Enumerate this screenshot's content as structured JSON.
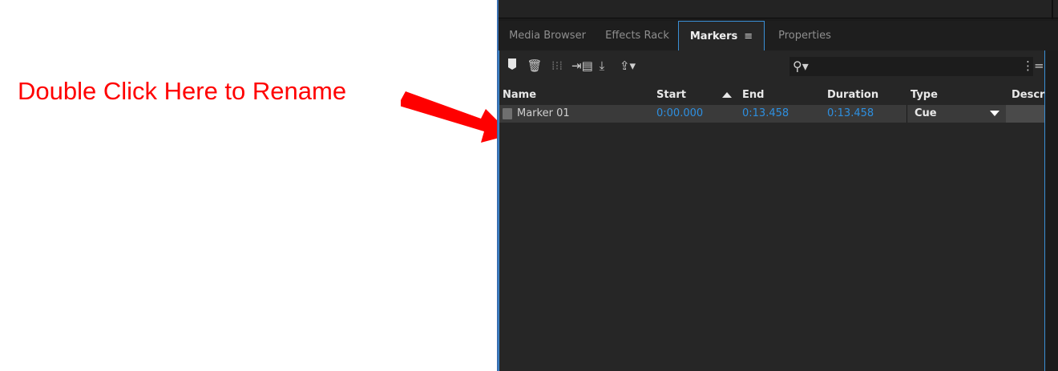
{
  "annotation": {
    "text": "Double Click Here to Rename",
    "color": "#ff0000"
  },
  "tabs": [
    {
      "label": "Media Browser",
      "active": false
    },
    {
      "label": "Effects Rack",
      "active": false
    },
    {
      "label": "Markers",
      "active": true
    },
    {
      "label": "Properties",
      "active": false
    }
  ],
  "toolbar": {
    "icons": [
      "marker-add-icon",
      "trash-icon",
      "merge-markers-icon",
      "insert-into-playlist-icon",
      "export-markers-icon",
      "import-markers-icon",
      "filter-icon"
    ],
    "search_placeholder": ""
  },
  "table": {
    "columns": [
      "Name",
      "Start",
      "End",
      "Duration",
      "Type",
      "Descr"
    ],
    "sort_column": "Start",
    "rows": [
      {
        "name": "Marker 01",
        "start": "0:00.000",
        "end": "0:13.458",
        "duration": "0:13.458",
        "type": "Cue",
        "description": ""
      }
    ]
  },
  "colors": {
    "accent": "#3a8fd6",
    "time_text": "#2d8fe0",
    "panel_bg": "#262626",
    "annotation_red": "#ff0000"
  }
}
